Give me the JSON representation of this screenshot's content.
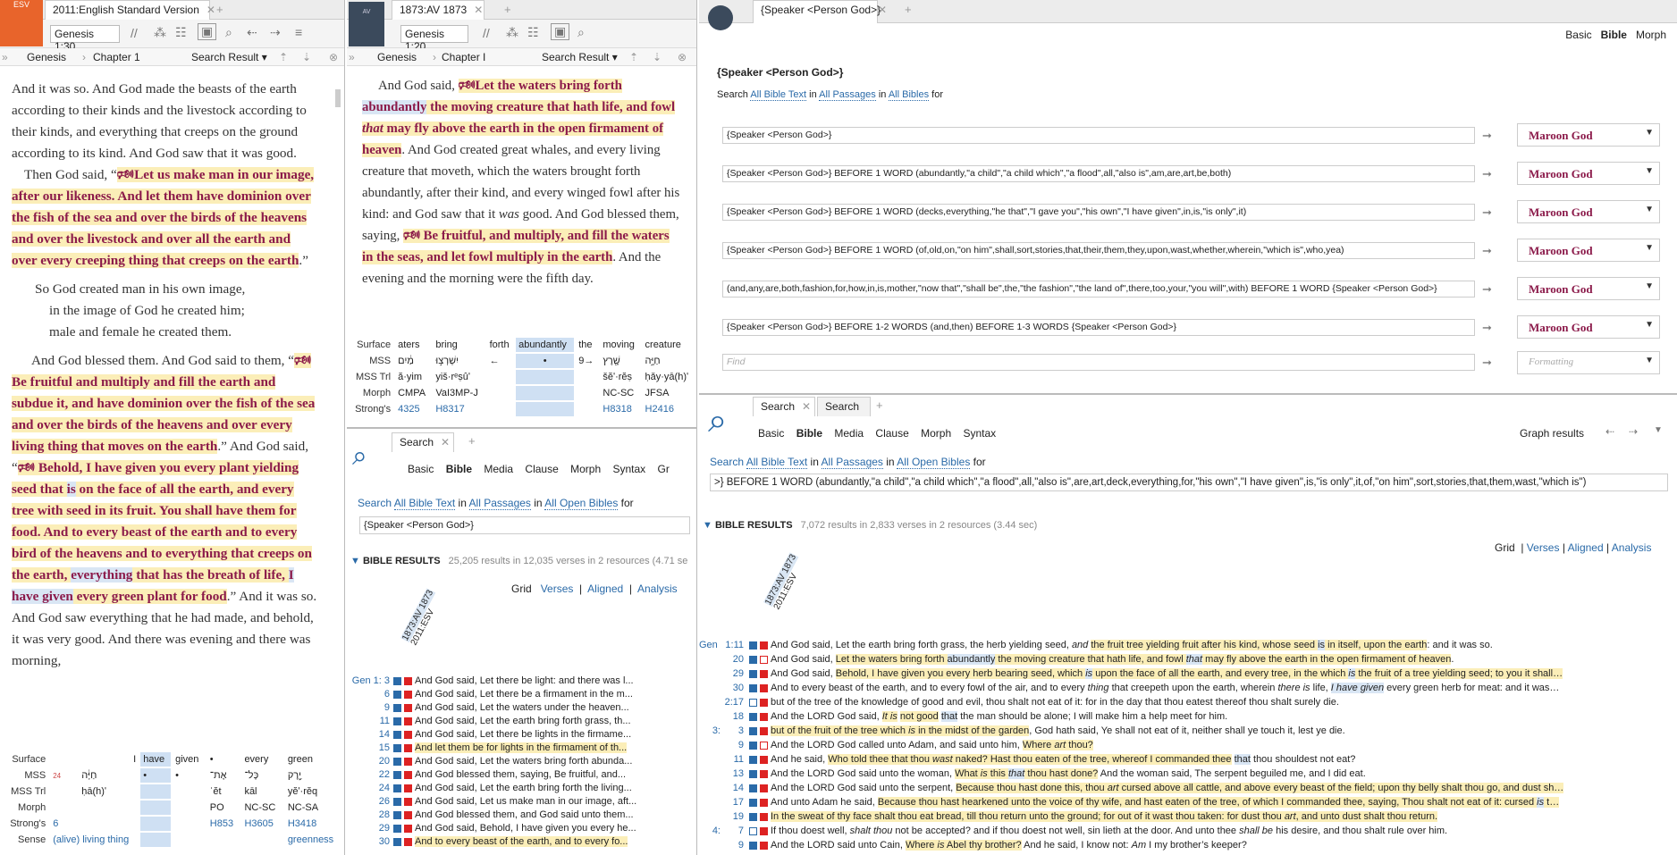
{
  "p1": {
    "tab": "2011:English Standard Version",
    "ref": "Genesis 1:30",
    "crumb_book": "Genesis",
    "crumb_chapter": "Chapter 1",
    "search_result": "Search Result ▾",
    "ilt": {
      "labels": [
        "Surface",
        "MSS",
        "MSS Trl",
        "Morph",
        "Strong's",
        "Sense"
      ],
      "cols": [
        "I",
        "have",
        "given",
        "•",
        "every",
        "green"
      ],
      "mss": [
        "חַיָּ֔ה",
        "•",
        "•",
        "אֶת־",
        "כָּל־",
        "יֶ֣רֶק"
      ],
      "trl": [
        "ḥā(h)ʹ",
        "",
        "",
        "ʾĕt",
        "kāl",
        "yĕʹ·rĕq"
      ],
      "morph": [
        "",
        "",
        "",
        "PO",
        "NC-SC",
        "NC-SA"
      ],
      "strongs": [
        "6",
        "",
        "",
        "H853",
        "H3605",
        "H3418"
      ],
      "sense": [
        "(alive) living thing",
        "",
        "",
        "",
        "",
        "greenness"
      ]
    }
  },
  "p2": {
    "tab": "1873:AV 1873",
    "ref": "Genesis 1:20",
    "crumb_book": "Genesis",
    "crumb_chapter": "Chapter I",
    "search_result": "Search Result ▾",
    "ilt": {
      "labels": [
        "Surface",
        "MSS",
        "MSS Trl",
        "Morph",
        "Strong's"
      ],
      "cols": [
        "aters",
        "bring",
        "forth",
        "abundantly",
        "the",
        "moving",
        "creature"
      ],
      "mss": [
        "מַ֔יִם",
        "יִשְׁרְצ֣וּ",
        "←",
        "•",
        "9→",
        "שֶׁ֖רֶץ",
        "חַיָּ֑ה"
      ],
      "trl": [
        "ă·yim",
        "yiš·rᵉṣûʹ",
        "",
        "",
        "",
        "šĕʹ·rĕṣ",
        "ḥǎy·yā(h)ʹ"
      ],
      "morph": [
        "CMPA",
        "VaI3MP-J",
        "",
        "",
        "",
        "NC-SC",
        "JFSA"
      ],
      "strongs": [
        "4325",
        "H8317",
        "",
        "",
        "",
        "H8318",
        "H2416"
      ]
    },
    "search": {
      "tab1": "Search",
      "kinds": [
        "Basic",
        "Bible",
        "Media",
        "Clause",
        "Morph",
        "Syntax",
        "Gr"
      ],
      "scope_prefix": "Search",
      "scope_text": "All Bible Text",
      "in1": "in",
      "scope_passages": "All Passages",
      "in2": "in",
      "scope_bibles": "All Open Bibles",
      "for": "for",
      "query": "{Speaker <Person God>}",
      "results_title": "BIBLE RESULTS",
      "results_meta": "25,205 results in 12,035 verses in 2 resources (4.71 se",
      "views": [
        "Grid",
        "Verses",
        "Aligned",
        "Analysis"
      ],
      "col1": "1873:AV 1873",
      "col2": "2011:ESV",
      "rows": [
        {
          "ref": "Gen 1: 3",
          "text": "And God said, Let there be light: and there was l..."
        },
        {
          "ref": "6",
          "text": "And God said, Let there be a firmament in the m..."
        },
        {
          "ref": "9",
          "text": "And God said, Let the waters under the heaven..."
        },
        {
          "ref": "11",
          "text": "And God said, Let the earth bring forth grass, th..."
        },
        {
          "ref": "14",
          "text": "And God said, Let there be lights in the firmame..."
        },
        {
          "ref": "15",
          "text": "And let them be for lights in the firmament of th..."
        },
        {
          "ref": "20",
          "text": "And God said, Let the waters bring forth abunda..."
        },
        {
          "ref": "22",
          "text": "And God blessed them, saying, Be fruitful, and..."
        },
        {
          "ref": "24",
          "text": "And God said, Let the earth bring forth the living..."
        },
        {
          "ref": "26",
          "text": "And God said, Let us make man in our image, aft..."
        },
        {
          "ref": "28",
          "text": "And God blessed them, and God said unto them..."
        },
        {
          "ref": "29",
          "text": "And God said, Behold, I have given you every he..."
        },
        {
          "ref": "30",
          "text": "And to every beast of the earth, and to every fo..."
        }
      ]
    }
  },
  "p3": {
    "tab": "{Speaker <Person God>}",
    "views": [
      "Basic",
      "Bible",
      "Morph"
    ],
    "title": "{Speaker <Person God>}",
    "scope_prefix": "Search",
    "scope_text": "All Bible Text",
    "in1": "in",
    "scope_passages": "All Passages",
    "in2": "in",
    "scope_bibles": "All Bibles",
    "for": "for",
    "rows": [
      {
        "q": "{Speaker <Person God>}",
        "fmt": "Maroon God"
      },
      {
        "q": "{Speaker <Person God>} BEFORE 1 WORD (abundantly,\"a child\",\"a child which\",\"a flood\",all,\"also is\",am,are,art,be,both)",
        "fmt": "Maroon God"
      },
      {
        "q": "{Speaker <Person God>} BEFORE 1 WORD (decks,everything,\"he that\",\"I gave you\",\"his own\",\"I have given\",in,is,\"is only\",it)",
        "fmt": "Maroon God"
      },
      {
        "q": "{Speaker <Person God>} BEFORE 1 WORD (of,old,on,\"on him\",shall,sort,stories,that,their,them,they,upon,wast,whether,wherein,\"which is\",who,yea)",
        "fmt": "Maroon God"
      },
      {
        "q": "(and,any,are,both,fashion,for,how,in,is,mother,\"now that\",\"shall be\",the,\"the fashion\",\"the land of\",there,too,your,\"you will\",with) BEFORE 1 WORD {Speaker <Person God>}",
        "fmt": "Maroon God"
      },
      {
        "q": "{Speaker <Person God>} BEFORE 1-2 WORDS (and,then) BEFORE 1-3 WORDS {Speaker <Person God>}",
        "fmt": "Maroon God"
      }
    ],
    "find_ph": "Find",
    "fmt_ph": "Formatting",
    "search": {
      "tab1": "Search",
      "tab2": "Search",
      "kinds": [
        "Basic",
        "Bible",
        "Media",
        "Clause",
        "Morph",
        "Syntax"
      ],
      "graph": "Graph results",
      "scope_prefix": "Search",
      "scope_text": "All Bible Text",
      "in1": "in",
      "scope_passages": "All Passages",
      "in2": "in",
      "scope_bibles": "All Open Bibles",
      "for": "for",
      "query": ">} BEFORE 1 WORD (abundantly,\"a child\",\"a child which\",\"a flood\",all,\"also is\",are,art,deck,everything,for,\"his own\",\"I have given\",is,\"is only\",it,of,\"on him\",sort,stories,that,them,wast,\"which is\")",
      "results_title": "BIBLE RESULTS",
      "results_meta": "7,072 results in 2,833 verses in 2 resources (3.44 sec)",
      "views": [
        "Grid",
        "Verses",
        "Aligned",
        "Analysis"
      ],
      "col1": "1873:AV 1873",
      "col2": "2011:ESV"
    }
  }
}
